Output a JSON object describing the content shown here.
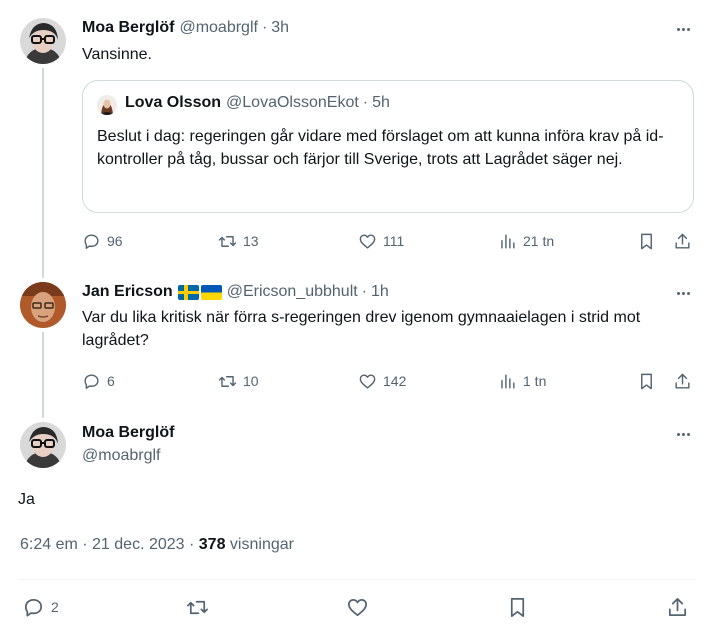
{
  "tweets": [
    {
      "name": "Moa Berglöf",
      "handle": "@moabrglf",
      "time": "3h",
      "text": "Vansinne.",
      "quote": {
        "name": "Lova Olsson",
        "handle": "@LovaOlssonEkot",
        "time": "5h",
        "text": "Beslut i dag: regeringen går vidare med förslaget om att kunna införa krav på id-kontroller på tåg, bussar och färjor till Sverige, trots att Lagrådet säger nej."
      },
      "replies": "96",
      "retweets": "13",
      "likes": "111",
      "views": "21 tn"
    },
    {
      "name": "Jan Ericson",
      "handle": "@Ericson_ubbhult",
      "time": "1h",
      "text": "Var du lika kritisk när förra s-regeringen drev igenom gymnaaielagen i strid mot lagrådet?",
      "replies": "6",
      "retweets": "10",
      "likes": "142",
      "views": "1 tn"
    }
  ],
  "main": {
    "name": "Moa Berglöf",
    "handle": "@moabrglf",
    "text": "Ja",
    "timestamp": "6:24 em · 21 dec. 2023 · ",
    "views_count": "378",
    "views_label": " visningar",
    "replies": "2"
  },
  "separator": "·",
  "icons": [
    "reply-icon",
    "retweet-icon",
    "like-icon",
    "views-icon",
    "bookmark-icon",
    "share-icon",
    "more-icon"
  ]
}
